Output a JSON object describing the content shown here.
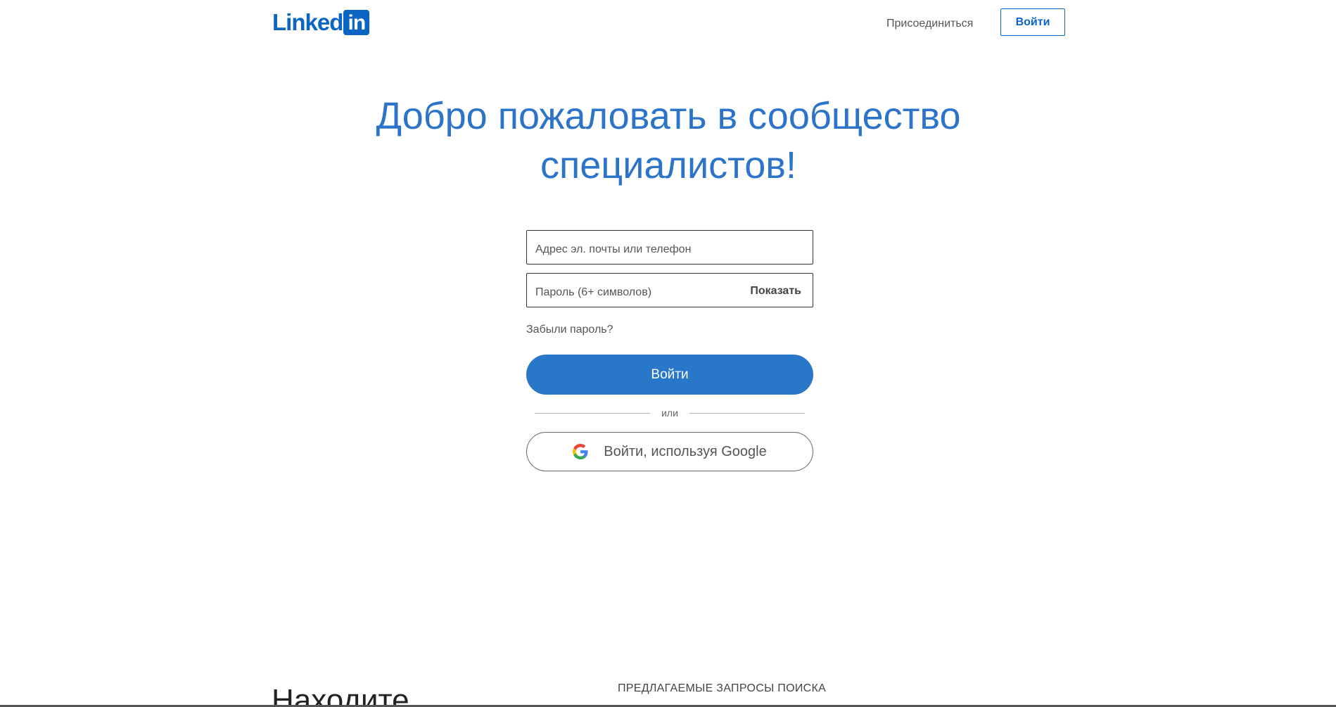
{
  "header": {
    "logo_text": "Linked",
    "logo_box_text": "in",
    "join_label": "Присоединиться",
    "signin_label": "Войти",
    "brand_color": "#0a66c2"
  },
  "hero": {
    "title": "Добро пожаловать в сообщество специалистов!"
  },
  "form": {
    "email_placeholder": "Адрес эл. почты или телефон",
    "email_value": "",
    "password_placeholder": "Пароль (6+ символов)",
    "password_value": "",
    "show_label": "Показать",
    "forgot_label": "Забыли пароль?",
    "submit_label": "Войти",
    "submit_color": "#2977c9",
    "divider_label": "или",
    "google_label": "Войти, используя Google",
    "google_icon": "google-g-icon"
  },
  "bottom": {
    "heading": "Находите",
    "suggested_label": "ПРЕДЛАГАЕМЫЕ ЗАПРОСЫ ПОИСКА"
  }
}
